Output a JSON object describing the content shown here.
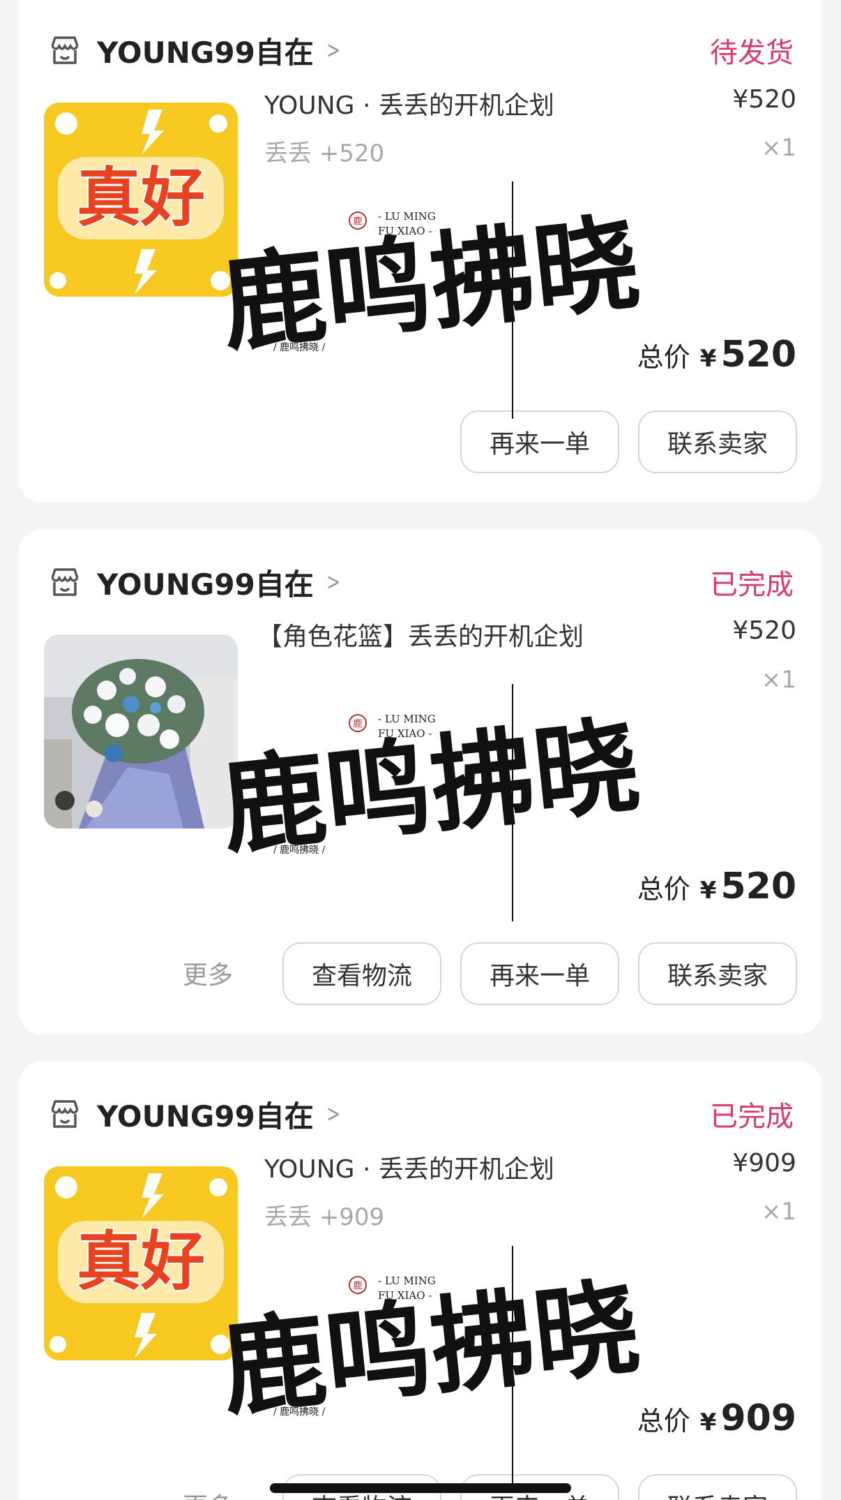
{
  "orders": [
    {
      "shop": "YOUNG99自在",
      "status": "待发货",
      "title": "YOUNG · 丢丢的开机企划",
      "price": "¥520",
      "spec": "丢丢 +520",
      "qty": "×1",
      "total_label": "总价",
      "total_currency": "¥",
      "total_value": "520",
      "buttons": [
        "再来一单",
        "联系卖家"
      ],
      "thumb": "zhenhao-image"
    },
    {
      "shop": "YOUNG99自在",
      "status": "已完成",
      "title": "【角色花篮】丢丢的开机企划",
      "price": "¥520",
      "qty": "×1",
      "total_label": "总价",
      "total_currency": "¥",
      "total_value": "520",
      "more": "更多",
      "buttons": [
        "查看物流",
        "再来一单",
        "联系卖家"
      ],
      "thumb": "flower-basket-photo"
    },
    {
      "shop": "YOUNG99自在",
      "status": "已完成",
      "title": "YOUNG · 丢丢的开机企划",
      "price": "¥909",
      "spec": "丢丢 +909",
      "qty": "×1",
      "total_label": "总价",
      "total_currency": "¥",
      "total_value": "909",
      "more": "更多",
      "buttons": [
        "查看物流",
        "再来一单",
        "联系卖家"
      ],
      "thumb": "zhenhao-image"
    }
  ],
  "thumb_text": "真好",
  "watermark": {
    "calligraphy": "鹿鸣拂晓",
    "seal": "鹿",
    "latin_1": "- LU MING",
    "latin_2": "FU XIAO -",
    "caption": "/ 鹿鸣拂晓 /"
  },
  "colors": {
    "status": "#d83a6b",
    "thumb_yellow": "#f7c81f",
    "thumb_red": "#e8421f"
  }
}
